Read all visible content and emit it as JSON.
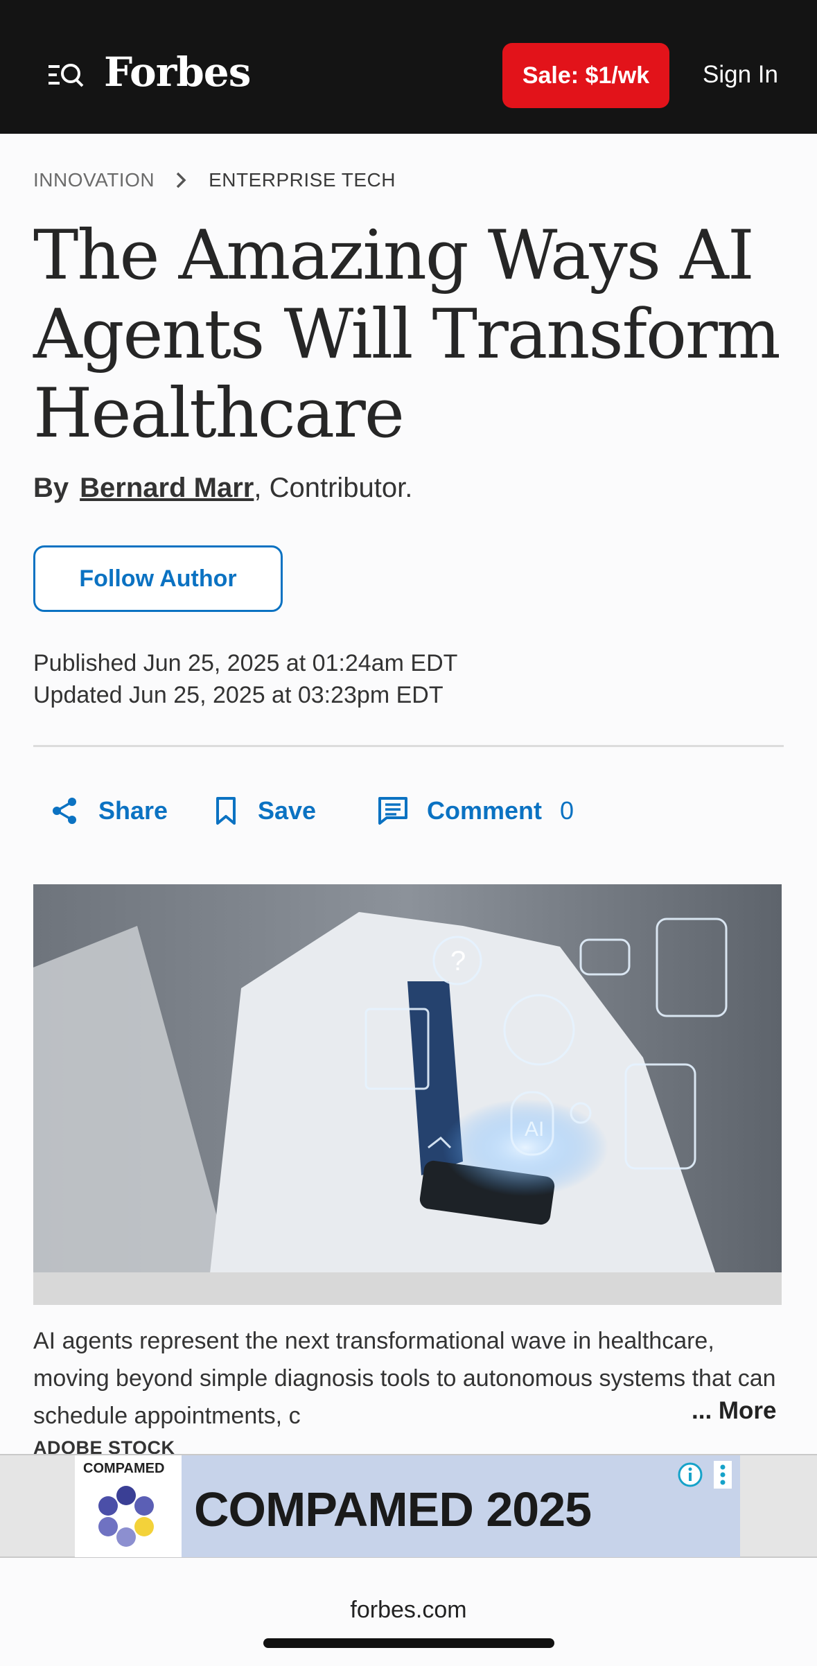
{
  "header": {
    "brand": "Forbes",
    "sale_label": "Sale: $1/wk",
    "signin_label": "Sign In"
  },
  "breadcrumb": {
    "section": "INNOVATION",
    "subsection": "ENTERPRISE TECH"
  },
  "article": {
    "title": "The Amazing Ways AI Agents Will Transform Healthcare",
    "byline_prefix": "By",
    "author": "Bernard Marr",
    "author_role": ", Contributor.",
    "follow_label": "Follow Author",
    "published": "Published Jun 25, 2025 at 01:24am EDT",
    "updated": "Updated Jun 25, 2025 at 03:23pm EDT"
  },
  "actions": {
    "share_label": "Share",
    "save_label": "Save",
    "comment_label": "Comment",
    "comment_count": "0"
  },
  "hero": {
    "ai_label": "AI"
  },
  "caption": {
    "text": "AI agents represent the next transformational wave in healthcare, moving beyond simple diagnosis tools to autonomous systems that can schedule appointments, c",
    "more_label": "... More",
    "credit": "ADOBE STOCK"
  },
  "ad": {
    "logo_text": "COMPAMED",
    "title": "COMPAMED 2025"
  },
  "browser": {
    "url": "forbes.com"
  },
  "colors": {
    "header_bg": "#141414",
    "sale_red": "#e2131a",
    "link_blue": "#0b72c2"
  }
}
